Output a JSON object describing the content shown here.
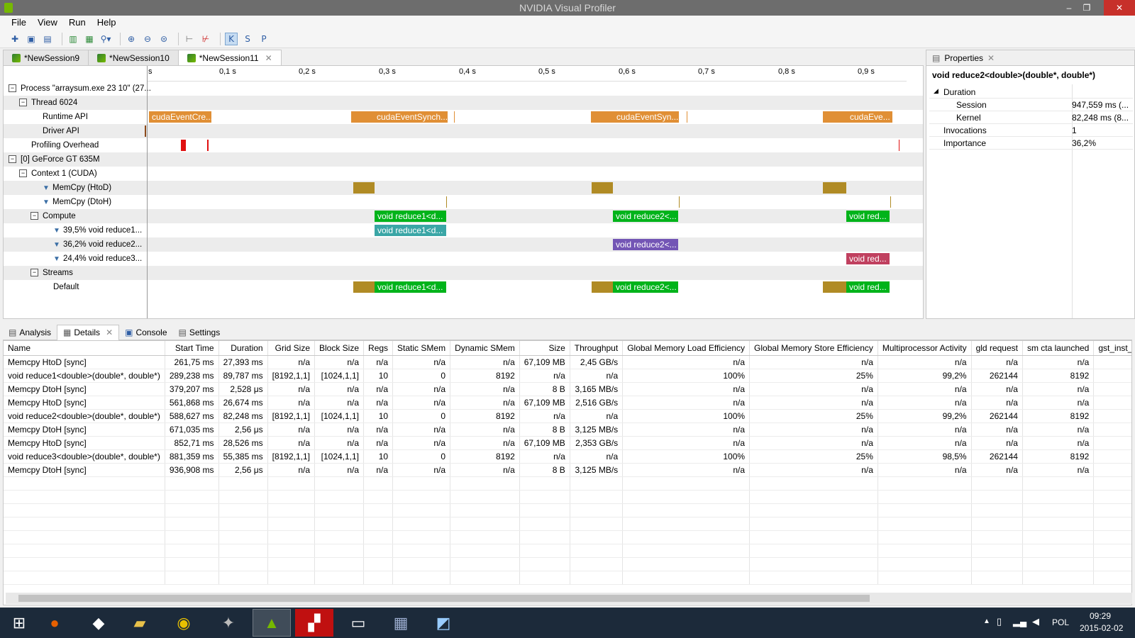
{
  "window": {
    "title": "NVIDIA Visual Profiler",
    "minimize": "–",
    "restore": "❐",
    "close": "✕"
  },
  "menu": [
    "File",
    "View",
    "Run",
    "Help"
  ],
  "sessions": [
    "*NewSession9",
    "*NewSession10",
    "*NewSession11"
  ],
  "timeline": {
    "ticks": [
      "s",
      "0,1 s",
      "0,2 s",
      "0,3 s",
      "0,4 s",
      "0,5 s",
      "0,6 s",
      "0,7 s",
      "0,8 s",
      "0,9 s"
    ],
    "rows": [
      "Process \"arraysum.exe 23 10\" (27...",
      "Thread 6024",
      "Runtime API",
      "Driver API",
      "Profiling Overhead",
      "[0] GeForce GT 635M",
      "Context 1 (CUDA)",
      "MemCpy (HtoD)",
      "MemCpy (DtoH)",
      "Compute",
      "39,5% void reduce1...",
      "36,2% void reduce2...",
      "24,4% void reduce3...",
      "Streams",
      "Default"
    ],
    "bars": {
      "runtime": [
        "cudaEventCre...",
        "cudaEventSynch...",
        "cudaEventSyn...",
        "cudaEve..."
      ],
      "compute": [
        "void reduce1<d...",
        "void reduce2<...",
        "void red..."
      ],
      "k1": "void reduce1<d...",
      "k2": "void reduce2<...",
      "k3": "void red...",
      "default": [
        "void reduce1<d...",
        "void reduce2<...",
        "void red..."
      ]
    }
  },
  "properties": {
    "tab": "Properties",
    "title": "void reduce2<double>(double*, double*)",
    "rows": [
      {
        "key": "Duration",
        "value": ""
      },
      {
        "key": "Session",
        "value": "947,559 ms (..."
      },
      {
        "key": "Kernel",
        "value": "82,248 ms (8..."
      },
      {
        "key": "Invocations",
        "value": "1"
      },
      {
        "key": "Importance",
        "value": "36,2%"
      }
    ]
  },
  "bottom_tabs": [
    "Analysis",
    "Details",
    "Console",
    "Settings"
  ],
  "details": {
    "columns": [
      "Name",
      "Start Time",
      "Duration",
      "Grid Size",
      "Block Size",
      "Regs",
      "Static SMem",
      "Dynamic SMem",
      "Size",
      "Throughput",
      "Global Memory Load Efficiency",
      "Global Memory Store Efficiency",
      "Multiprocessor Activity",
      "gld request",
      "sm cta launched",
      "gst_inst_"
    ],
    "rows": [
      [
        "Memcpy HtoD [sync]",
        "261,75 ms",
        "27,393 ms",
        "n/a",
        "n/a",
        "n/a",
        "n/a",
        "n/a",
        "67,109 MB",
        "2,45 GB/s",
        "n/a",
        "n/a",
        "n/a",
        "n/a",
        "n/a",
        ""
      ],
      [
        "void reduce1<double>(double*, double*)",
        "289,238 ms",
        "89,787 ms",
        "[8192,1,1]",
        "[1024,1,1]",
        "10",
        "0",
        "8192",
        "n/a",
        "n/a",
        "100%",
        "25%",
        "99,2%",
        "262144",
        "8192",
        ""
      ],
      [
        "Memcpy DtoH [sync]",
        "379,207 ms",
        "2,528 μs",
        "n/a",
        "n/a",
        "n/a",
        "n/a",
        "n/a",
        "8 B",
        "3,165 MB/s",
        "n/a",
        "n/a",
        "n/a",
        "n/a",
        "n/a",
        ""
      ],
      [
        "Memcpy HtoD [sync]",
        "561,868 ms",
        "26,674 ms",
        "n/a",
        "n/a",
        "n/a",
        "n/a",
        "n/a",
        "67,109 MB",
        "2,516 GB/s",
        "n/a",
        "n/a",
        "n/a",
        "n/a",
        "n/a",
        ""
      ],
      [
        "void reduce2<double>(double*, double*)",
        "588,627 ms",
        "82,248 ms",
        "[8192,1,1]",
        "[1024,1,1]",
        "10",
        "0",
        "8192",
        "n/a",
        "n/a",
        "100%",
        "25%",
        "99,2%",
        "262144",
        "8192",
        ""
      ],
      [
        "Memcpy DtoH [sync]",
        "671,035 ms",
        "2,56 μs",
        "n/a",
        "n/a",
        "n/a",
        "n/a",
        "n/a",
        "8 B",
        "3,125 MB/s",
        "n/a",
        "n/a",
        "n/a",
        "n/a",
        "n/a",
        ""
      ],
      [
        "Memcpy HtoD [sync]",
        "852,71 ms",
        "28,526 ms",
        "n/a",
        "n/a",
        "n/a",
        "n/a",
        "n/a",
        "67,109 MB",
        "2,353 GB/s",
        "n/a",
        "n/a",
        "n/a",
        "n/a",
        "n/a",
        ""
      ],
      [
        "void reduce3<double>(double*, double*)",
        "881,359 ms",
        "55,385 ms",
        "[8192,1,1]",
        "[1024,1,1]",
        "10",
        "0",
        "8192",
        "n/a",
        "n/a",
        "100%",
        "25%",
        "98,5%",
        "262144",
        "8192",
        ""
      ],
      [
        "Memcpy DtoH [sync]",
        "936,908 ms",
        "2,56 μs",
        "n/a",
        "n/a",
        "n/a",
        "n/a",
        "n/a",
        "8 B",
        "3,125 MB/s",
        "n/a",
        "n/a",
        "n/a",
        "n/a",
        "n/a",
        ""
      ]
    ]
  },
  "tray": {
    "lang": "POL",
    "time": "09:29",
    "date": "2015-02-02"
  },
  "colors": {
    "runtime": "#e08f35",
    "memcpy": "#b08b25",
    "compute": "#00b31a",
    "k1": "#3aa6a6",
    "k2": "#7355b5",
    "k3": "#c0405f"
  }
}
